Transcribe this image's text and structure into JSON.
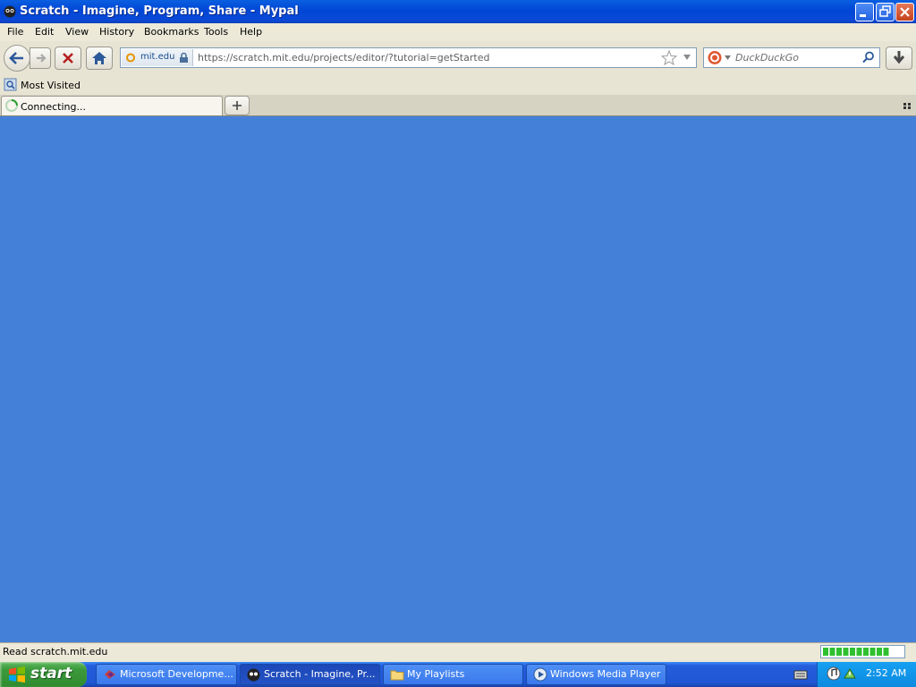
{
  "window": {
    "title": "Scratch - Imagine, Program, Share - Mypal"
  },
  "menu": [
    "File",
    "Edit",
    "View",
    "History",
    "Bookmarks",
    "Tools",
    "Help"
  ],
  "nav": {
    "identity_label": "mit.edu",
    "url": "https://scratch.mit.edu/projects/editor/?tutorial=getStarted",
    "search_placeholder": "DuckDuckGo"
  },
  "bookmarks": {
    "most_visited": "Most Visited"
  },
  "tabs": [
    {
      "label": "Connecting..."
    }
  ],
  "status": {
    "text": "Read scratch.mit.edu",
    "progress_segments_filled": 10,
    "progress_segments_total": 12
  },
  "taskbar": {
    "start_label": "start",
    "tasks": [
      {
        "label": "Microsoft Developme..."
      },
      {
        "label": "Scratch - Imagine, Pr..."
      },
      {
        "label": "My Playlists"
      },
      {
        "label": "Windows Media Player"
      }
    ],
    "clock": "2:52 AM"
  },
  "colors": {
    "content_bg": "#4580d8",
    "titlebar": "#0046d5",
    "taskbar": "#245edb",
    "start_green": "#3c9a3c"
  }
}
